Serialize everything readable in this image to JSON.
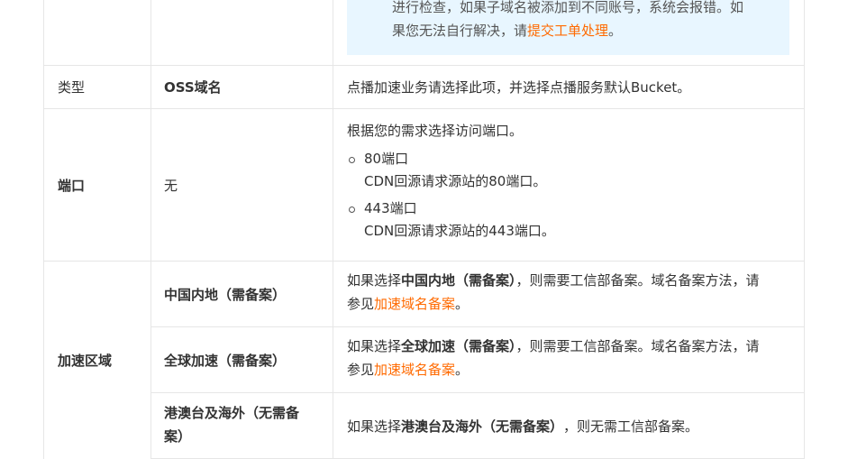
{
  "note": {
    "line1": "进行检查，如果子域名被添加到不同账号，系统会报错。如",
    "line2_prefix": "果您无法自行解决，请",
    "line2_link": "提交工单处理",
    "line2_suffix": "。"
  },
  "rows": {
    "type": {
      "label": "类型",
      "value": "OSS域名",
      "desc": "点播加速业务请选择此项，并选择点播服务默认Bucket。"
    },
    "port": {
      "label": "端口",
      "value": "无",
      "desc": "根据您的需求选择访问端口。",
      "options": [
        {
          "title": "80端口",
          "detail": "CDN回源请求源站的80端口。"
        },
        {
          "title": "443端口",
          "detail": "CDN回源请求源站的443端口。"
        }
      ]
    },
    "region": {
      "label": "加速区域",
      "items": [
        {
          "value": "中国内地（需备案）",
          "desc_prefix": "如果选择",
          "desc_bold": "中国内地（需备案）",
          "desc_mid": "，则需要工信部备案。域名备案方法，请",
          "desc_line2_prefix": "参见",
          "desc_link": "加速域名备案",
          "desc_suffix": "。"
        },
        {
          "value": "全球加速（需备案）",
          "desc_prefix": "如果选择",
          "desc_bold": "全球加速（需备案）",
          "desc_mid": "，则需要工信部备案。域名备案方法，请",
          "desc_line2_prefix": "参见",
          "desc_link": "加速域名备案",
          "desc_suffix": "。"
        },
        {
          "value_line1": "港澳台及海外（无需备",
          "value_line2": "案）",
          "desc_prefix": "如果选择",
          "desc_bold": "港澳台及海外（无需备案）",
          "desc_suffix": "，则无需工信部备案。"
        }
      ]
    }
  }
}
